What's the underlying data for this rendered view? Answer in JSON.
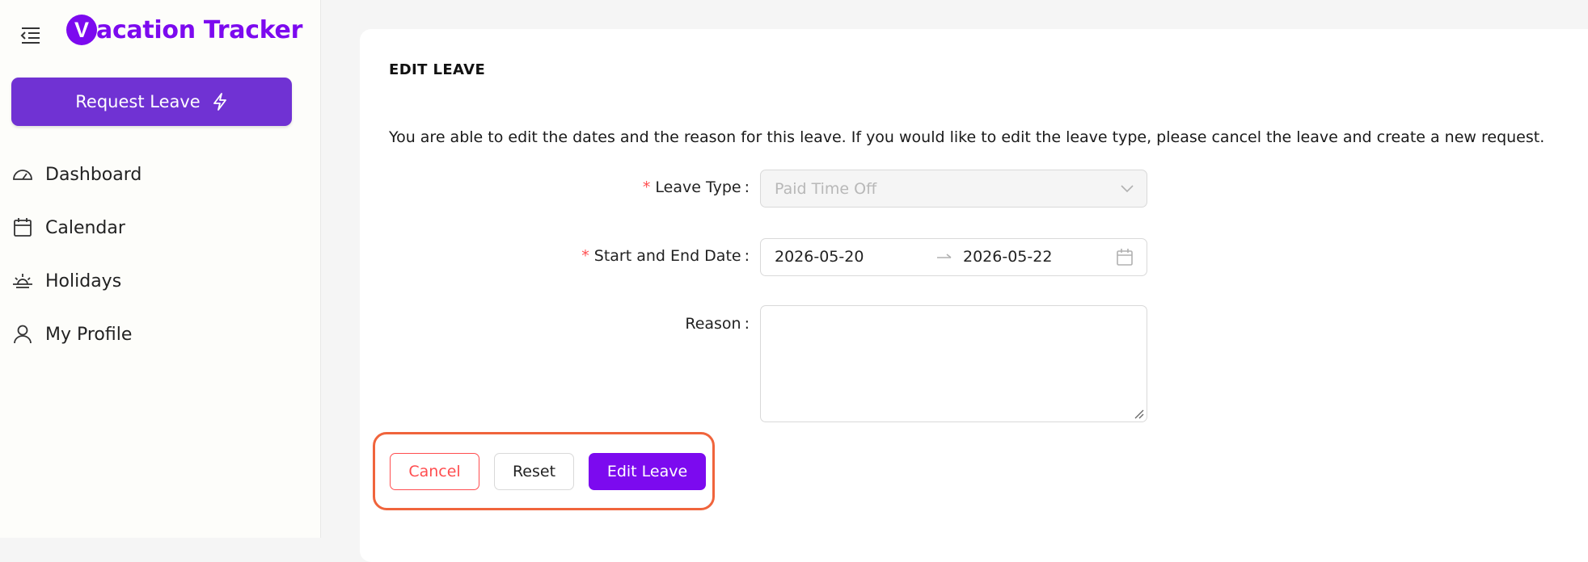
{
  "app": {
    "brand_mark_letter": "V",
    "brand_name": "acation Tracker",
    "brand_color": "#7c0aef"
  },
  "sidebar": {
    "request_button_label": "Request Leave",
    "items": [
      {
        "label": "Dashboard",
        "icon": "dashboard-gauge-icon"
      },
      {
        "label": "Calendar",
        "icon": "calendar-icon"
      },
      {
        "label": "Holidays",
        "icon": "sunrise-icon"
      },
      {
        "label": "My Profile",
        "icon": "user-icon"
      }
    ]
  },
  "main": {
    "title": "EDIT LEAVE",
    "description": "You are able to edit the dates and the reason for this leave. If you would like to edit the leave type, please cancel the leave and create a new request.",
    "form": {
      "leave_type_label": "Leave Type",
      "leave_type_value": "Paid Time Off",
      "date_label": "Start and End Date",
      "start_date": "2026-05-20",
      "end_date": "2026-05-22",
      "reason_label": "Reason",
      "reason_value": "",
      "required_mark": "*",
      "colon": ":"
    },
    "actions": {
      "cancel_label": "Cancel",
      "reset_label": "Reset",
      "edit_label": "Edit Leave"
    }
  },
  "colors": {
    "accent": "#7c0aef",
    "request_button": "#7032d3",
    "danger": "#ff4d4f",
    "highlight_border": "#f0643c"
  }
}
